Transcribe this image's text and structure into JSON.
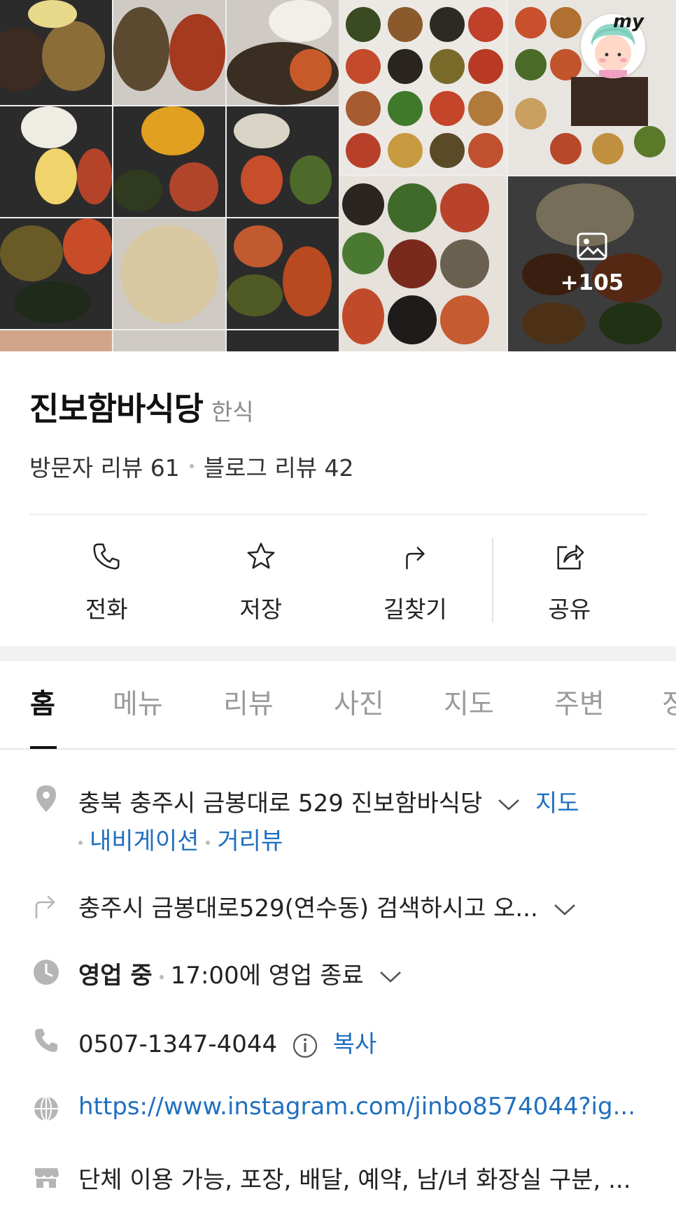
{
  "gallery": {
    "more_count": "+105",
    "avatar_badge": "my"
  },
  "place": {
    "name": "진보함바식당",
    "category": "한식",
    "visitor_reviews": "방문자 리뷰 61",
    "blog_reviews": "블로그 리뷰 42"
  },
  "actions": {
    "call": "전화",
    "save": "저장",
    "directions": "길찾기",
    "share": "공유"
  },
  "tabs": [
    "홈",
    "메뉴",
    "리뷰",
    "사진",
    "지도",
    "주변",
    "정"
  ],
  "info": {
    "address": "충북 충주시 금봉대로 529 진보함바식당",
    "map_link": "지도",
    "navigation_link": "내비게이션",
    "streetview_link": "거리뷰",
    "directions_text": "충주시 금봉대로529(연수동) 검색하시고 오...",
    "open_status": "영업 중",
    "close_time": "17:00에 영업 종료",
    "phone": "0507-1347-4044",
    "copy_label": "복사",
    "website": "https://www.instagram.com/jinbo8574044?ig...",
    "amenities": "단체 이용 가능, 포장, 배달, 예약, 남/녀 화장실 구분, ..."
  },
  "colors": {
    "link": "#1f6fc0",
    "icon_grey": "#b5b5b5"
  }
}
